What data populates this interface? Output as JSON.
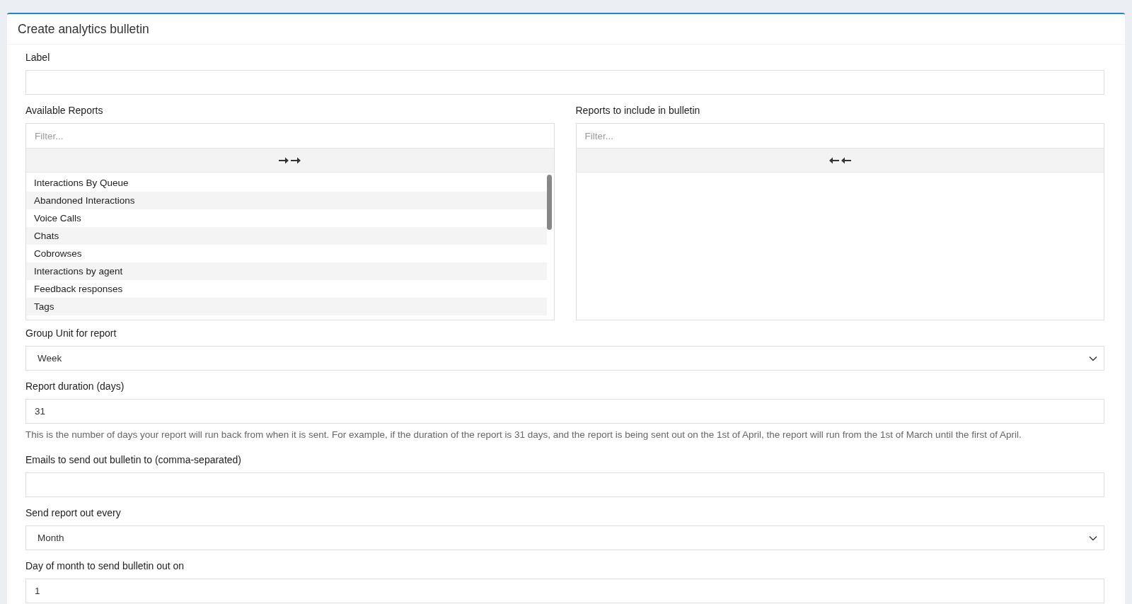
{
  "panel": {
    "title": "Create analytics bulletin"
  },
  "fields": [
    {
      "kind": "text",
      "label": "Label"
    },
    {
      "kind": "dual-list",
      "available": {
        "label": "Available Reports",
        "placeholder": "Filter...",
        "items": [
          "Interactions By Queue",
          "Abandoned Interactions",
          "Voice Calls",
          "Chats",
          "Cobrowses",
          "Interactions by agent",
          "Feedback responses",
          "Tags"
        ]
      },
      "selected_reports": {
        "label": "Reports to include in bulletin",
        "placeholder": "Filter..."
      }
    },
    {
      "kind": "select",
      "label": "Group Unit for report",
      "value": "Week"
    },
    {
      "kind": "text",
      "label": "Report duration (days)",
      "value": "31",
      "help": "This is the number of days your report will run back from when it is sent. For example, if the duration of the report is 31 days, and the report is being sent out on the 1st of April, the report will run from the 1st of March until the first of April."
    },
    {
      "kind": "text",
      "label": "Emails to send out bulletin to (comma-separated)"
    },
    {
      "kind": "select",
      "label": "Send report out every",
      "value": "Month"
    },
    {
      "kind": "text",
      "label": "Day of month to send bulletin out on",
      "value": "1"
    }
  ]
}
